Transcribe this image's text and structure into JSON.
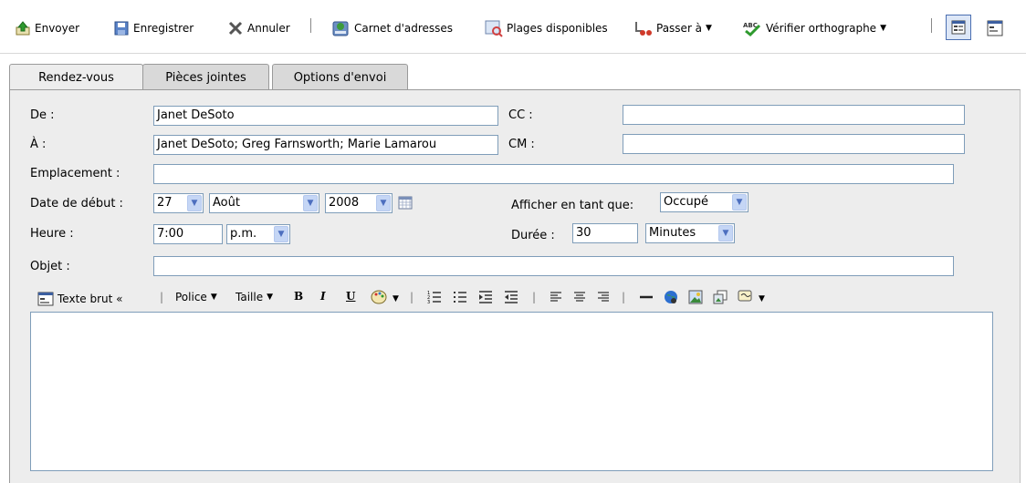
{
  "toolbar": {
    "send": "Envoyer",
    "save": "Enregistrer",
    "cancel": "Annuler",
    "address_book": "Carnet d'adresses",
    "busy_search": "Plages disponibles",
    "go_to": "Passer à",
    "spell_check": "Vérifier orthographe"
  },
  "tabs": [
    {
      "label": "Rendez-vous"
    },
    {
      "label": "Pièces jointes"
    },
    {
      "label": "Options d'envoi"
    }
  ],
  "form": {
    "from_label": "De :",
    "from_value": "Janet DeSoto",
    "to_label": "À :",
    "to_value": "Janet DeSoto; Greg Farnsworth; Marie Lamarou",
    "cc_label": "CC :",
    "cc_value": "",
    "bc_label": "CM :",
    "bc_value": "",
    "location_label": "Emplacement :",
    "location_value": "",
    "start_date_label": "Date de début :",
    "day": "27",
    "month": "Août",
    "year": "2008",
    "show_as_label": "Afficher en tant que:",
    "show_as_value": "Occupé",
    "time_label": "Heure :",
    "time_value": "7:00",
    "ampm": "p.m.",
    "duration_label": "Durée :",
    "duration_value": "30",
    "duration_unit": "Minutes",
    "subject_label": "Objet :",
    "subject_value": ""
  },
  "editor_toolbar": {
    "plain_text": "Texte brut «",
    "font": "Police",
    "size": "Taille",
    "bold": "B",
    "italic": "I",
    "underline": "U"
  },
  "colors": {
    "panel_bg": "#ededed",
    "field_border": "#7f9db9",
    "dropdown_bg": "#c5d6f5"
  }
}
